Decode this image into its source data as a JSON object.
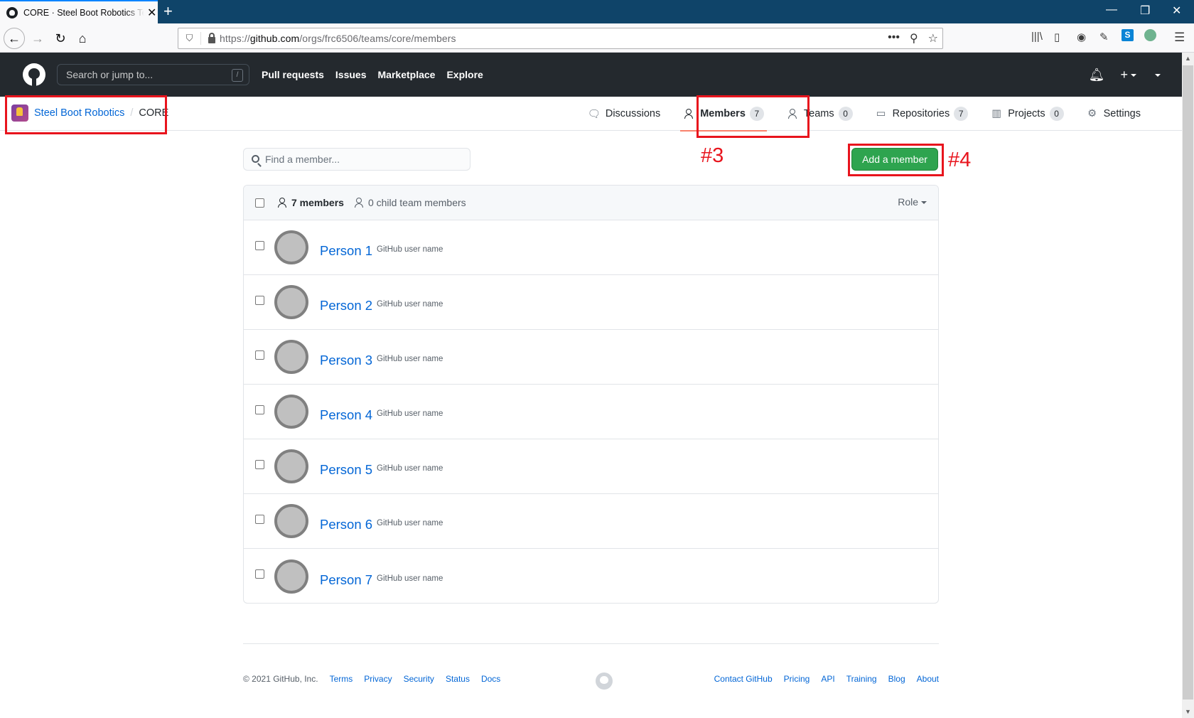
{
  "browser": {
    "tab_title": "CORE · Steel Boot Robotics Team",
    "new_tab_label": "+",
    "url_prefix": "https://",
    "url_domain": "github.com",
    "url_path": "/orgs/frc6506/teams/core/members",
    "window_controls": {
      "minimize": "—",
      "restore": "❐",
      "close": "✕"
    }
  },
  "github_header": {
    "search_placeholder": "Search or jump to...",
    "search_shortcut": "/",
    "nav": [
      "Pull requests",
      "Issues",
      "Marketplace",
      "Explore"
    ]
  },
  "breadcrumb": {
    "org": "Steel Boot Robotics",
    "separator": "/",
    "team": "CORE"
  },
  "team_tabs": [
    {
      "label": "Discussions",
      "icon": "comment-discussion-icon",
      "count": null,
      "active": false
    },
    {
      "label": "Members",
      "icon": "person-icon",
      "count": "7",
      "active": true
    },
    {
      "label": "Teams",
      "icon": "people-icon",
      "count": "0",
      "active": false
    },
    {
      "label": "Repositories",
      "icon": "repo-icon",
      "count": "7",
      "active": false
    },
    {
      "label": "Projects",
      "icon": "project-icon",
      "count": "0",
      "active": false
    },
    {
      "label": "Settings",
      "icon": "gear-icon",
      "count": null,
      "active": false
    }
  ],
  "main": {
    "find_placeholder": "Find a member...",
    "add_member_label": "Add a member",
    "members_count_label": "7 members",
    "child_members_label": "0 child team members",
    "role_filter_label": "Role"
  },
  "members": [
    {
      "name": "Person 1",
      "username": "GitHub user name"
    },
    {
      "name": "Person 2",
      "username": "GitHub user name"
    },
    {
      "name": "Person 3",
      "username": "GitHub user name"
    },
    {
      "name": "Person 4",
      "username": "GitHub user name"
    },
    {
      "name": "Person 5",
      "username": "GitHub user name"
    },
    {
      "name": "Person 6",
      "username": "GitHub user name"
    },
    {
      "name": "Person 7",
      "username": "GitHub user name"
    }
  ],
  "annotations": {
    "members_tab": "#3",
    "add_member": "#4",
    "color": "#e8141d"
  },
  "footer": {
    "copyright": "© 2021 GitHub, Inc.",
    "left_links": [
      "Terms",
      "Privacy",
      "Security",
      "Status",
      "Docs"
    ],
    "right_links": [
      "Contact GitHub",
      "Pricing",
      "API",
      "Training",
      "Blog",
      "About"
    ]
  },
  "colors": {
    "header_bg": "#24292e",
    "link": "#0366d6",
    "primary_button": "#2ea44f",
    "active_tab_underline": "#f9826c",
    "browser_titlebar": "#0f4469"
  }
}
